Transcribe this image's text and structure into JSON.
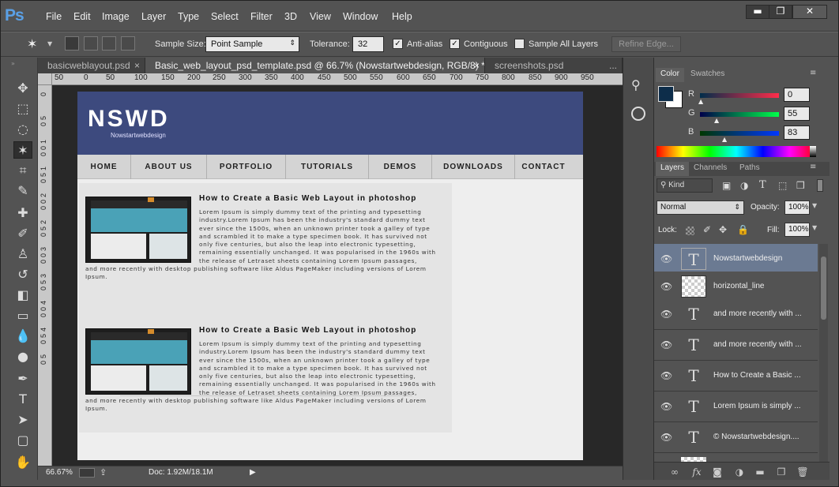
{
  "app": {
    "logo": "Ps",
    "menu": [
      "File",
      "Edit",
      "Image",
      "Layer",
      "Type",
      "Select",
      "Filter",
      "3D",
      "View",
      "Window",
      "Help"
    ]
  },
  "window_controls": {
    "minimize": "▬",
    "restore": "❐",
    "close": "✕"
  },
  "options": {
    "sample_size_label": "Sample Size:",
    "sample_size_value": "Point Sample",
    "tolerance_label": "Tolerance:",
    "tolerance_value": "32",
    "anti_alias_label": "Anti-alias",
    "anti_alias_checked": true,
    "contiguous_label": "Contiguous",
    "contiguous_checked": true,
    "sample_all_layers_label": "Sample All Layers",
    "sample_all_layers_checked": false,
    "refine_edge_label": "Refine Edge..."
  },
  "tabs": [
    {
      "label": "basicweblayout.psd",
      "close": "×"
    },
    {
      "label": "Basic_web_layout_psd_template.psd @ 66.7% (Nowstartwebdesign, RGB/8) *",
      "close": "×"
    },
    {
      "label": "screenshots.psd",
      "close": "..."
    }
  ],
  "ruler": {
    "top": [
      "50",
      "0",
      "50",
      "100",
      "150",
      "200",
      "250",
      "300",
      "350",
      "400",
      "450",
      "500",
      "550",
      "600",
      "650",
      "700",
      "750",
      "800",
      "850",
      "900",
      "950"
    ],
    "left": [
      "0",
      "5",
      "0",
      "1",
      "0",
      "0",
      "1",
      "5",
      "0",
      "2",
      "0",
      "0",
      "2",
      "5",
      "0",
      "3",
      "0",
      "0",
      "3",
      "5",
      "0",
      "4",
      "0",
      "0",
      "4",
      "5",
      "0",
      "5",
      "0"
    ]
  },
  "website": {
    "logo": "NSWD",
    "tagline": "Nowstartwebdesign",
    "nav": [
      "HOME",
      "ABOUT US",
      "PORTFOLIO",
      "TUTORIALS",
      "DEMOS",
      "DOWNLOADS",
      "CONTACT"
    ],
    "articles": [
      {
        "title": "How to Create a Basic Web Layout in photoshop",
        "lines": [
          "Lorem Ipsum is simply dummy text of the printing and typesetting",
          "industry.Lorem Ipsum has been the industry's standard dummy text",
          "ever since the 1500s, when an unknown printer took a galley of type",
          "and scrambled it to make a type specimen book. It has survived not",
          "only five centuries, but also the leap into electronic typesetting,",
          "remaining essentially unchanged. It was popularised in the 1960s with",
          "the release of Letraset sheets containing Lorem Ipsum passages,",
          "and more recently with desktop publishing software like Aldus PageMaker including versions of Lorem",
          "Ipsum."
        ]
      },
      {
        "title": "How to Create a Basic Web Layout in photoshop",
        "lines": [
          "Lorem Ipsum is simply dummy text of the printing and typesetting",
          "industry.Lorem Ipsum has been the industry's standard dummy text",
          "ever since the 1500s, when an unknown printer took a galley of type",
          "and scrambled it to make a type specimen book. It has survived not",
          "only five centuries, but also the leap into electronic typesetting,",
          "remaining essentially unchanged. It was popularised in the 1960s with",
          "the release of Letraset sheets containing Lorem Ipsum passages,",
          "and more recently with desktop publishing software like Aldus PageMaker including versions of Lorem",
          "Ipsum."
        ]
      }
    ]
  },
  "status": {
    "zoom": "66.67%",
    "doc": "Doc: 1.92M/18.1M",
    "arrow": "▶"
  },
  "color_panel": {
    "tabs": [
      "Color",
      "Swatches"
    ],
    "r_label": "R",
    "r": "0",
    "g_label": "G",
    "g": "55",
    "b_label": "B",
    "b": "83",
    "foreground": "#003753"
  },
  "layers_panel": {
    "tabs": [
      "Layers",
      "Channels",
      "Paths"
    ],
    "kind": "Kind",
    "blend_mode": "Normal",
    "opacity_label": "Opacity:",
    "opacity": "100%",
    "lock_label": "Lock:",
    "fill_label": "Fill:",
    "fill": "100%",
    "layers": [
      {
        "name": "Nowstartwebdesign",
        "type": "text",
        "selected": true
      },
      {
        "name": "horizontal_line",
        "type": "pixel",
        "selected": false
      },
      {
        "name": "and more recently with ...",
        "type": "text",
        "selected": false
      },
      {
        "name": "and more recently with ...",
        "type": "text",
        "selected": false
      },
      {
        "name": "How to Create a Basic ...",
        "type": "text",
        "selected": false
      },
      {
        "name": "Lorem Ipsum is simply ...",
        "type": "text",
        "selected": false
      },
      {
        "name": "© Nowstartwebdesign....",
        "type": "text",
        "selected": false
      }
    ]
  }
}
